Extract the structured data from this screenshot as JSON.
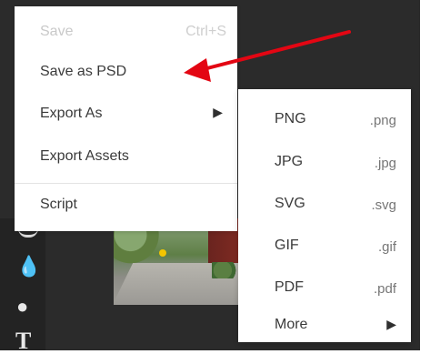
{
  "file_menu": {
    "items": [
      {
        "label": "Save",
        "shortcut": "Ctrl+S",
        "disabled": true
      },
      {
        "label": "Save as PSD"
      },
      {
        "label": "Export As",
        "has_submenu": true
      },
      {
        "label": "Export Assets"
      },
      {
        "label": "Script"
      }
    ]
  },
  "export_submenu": {
    "items": [
      {
        "label": "PNG",
        "extension": ".png"
      },
      {
        "label": "JPG",
        "extension": ".jpg"
      },
      {
        "label": "SVG",
        "extension": ".svg"
      },
      {
        "label": "GIF",
        "extension": ".gif"
      },
      {
        "label": "PDF",
        "extension": ".pdf"
      },
      {
        "label": "More",
        "has_submenu": true
      }
    ]
  },
  "icons": {
    "submenu_indicator": "caret-right-icon",
    "drop_tool": "drop-icon",
    "dodge_tool": "dodge-icon",
    "text_tool": "text-icon",
    "annotation": "red-arrow-icon"
  },
  "colors": {
    "annotation_arrow": "#e30613",
    "workspace": "#2b2b2b",
    "menu_background": "#ffffff",
    "disabled_text": "#c9c9c9"
  }
}
